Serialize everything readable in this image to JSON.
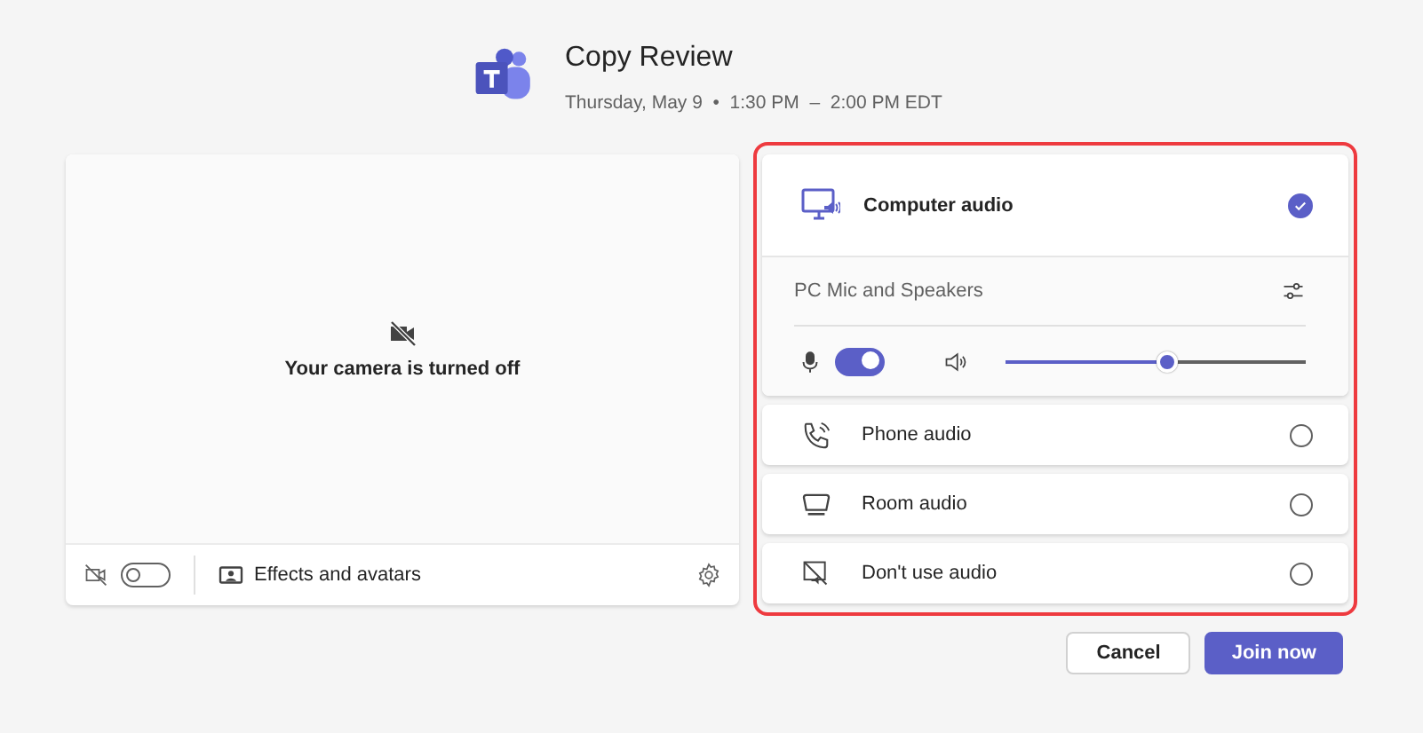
{
  "meeting": {
    "title": "Copy Review",
    "schedule": "Thursday, May 9  •  1:30 PM  –  2:00 PM EDT"
  },
  "camera": {
    "message": "Your camera is turned off",
    "on": false,
    "effects_label": "Effects and avatars"
  },
  "audio_options": [
    {
      "kind": "computer",
      "label": "Computer audio",
      "selected": true,
      "device": "PC Mic and Speakers",
      "mic_on": true,
      "speaker": {
        "level": 0.54
      }
    },
    {
      "kind": "phone",
      "label": "Phone audio",
      "selected": false
    },
    {
      "kind": "room",
      "label": "Room audio",
      "selected": false
    },
    {
      "kind": "none",
      "label": "Don't use audio",
      "selected": false
    }
  ],
  "buttons": [
    {
      "kind": "secondary",
      "label": "Cancel"
    },
    {
      "kind": "primary",
      "label": "Join now"
    }
  ]
}
